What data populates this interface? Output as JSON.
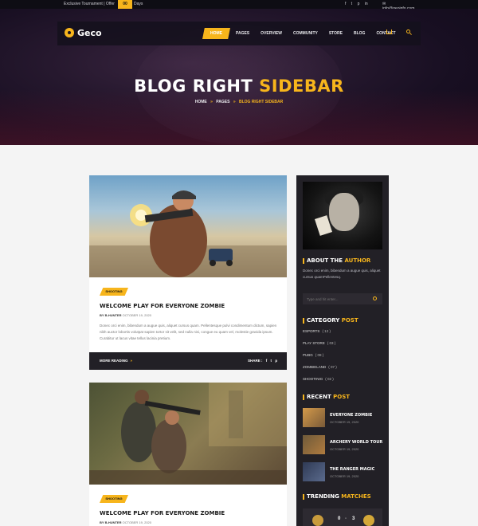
{
  "topbar": {
    "promo_text": "Exclusive Tournament | Offer",
    "promo_days_value": "00",
    "promo_days_label": "Days",
    "social_icons": [
      "facebook-icon",
      "twitter-icon",
      "pinterest-icon",
      "linkedin-icon"
    ],
    "email": "info@geoinfo.com"
  },
  "nav": {
    "logo": "Geco",
    "items": [
      "HOME",
      "PAGES",
      "OVERVIEW",
      "COMMUNITY",
      "STORE",
      "BLOG",
      "CONTACT"
    ],
    "active_index": 0
  },
  "hero": {
    "title_main": "BLOG RIGHT ",
    "title_accent": "SIDEBAR",
    "breadcrumb": [
      "HOME",
      "PAGES",
      "BLOG RIGHT SIDEBAR"
    ]
  },
  "posts": [
    {
      "tag": "SHOOTING",
      "title": "WELCOME PLAY FOR EVERYONE ZOMBIE",
      "author": "BY B-HUNTER",
      "date": "OCTOBER 19, 2020",
      "excerpt": "Donec orci enim, bibendum a augue quis, aliquet cursus quam. Pellentesque pulvi condimentum dictum, sapien nibh auctor lobortis volutpat sapien tortor sit velit, sed nulla nisi, congue eu quam vel, molestie gravida ipsum. Curabitur ut lacus vitae tellus lacinia pretium.",
      "more": "MORE READING",
      "share": "SHARE :"
    },
    {
      "tag": "SHOOTING",
      "title": "WELCOME PLAY FOR EVERYONE ZOMBIE",
      "author": "BY B-HUNTER",
      "date": "OCTOBER 19, 2020"
    }
  ],
  "sidebar": {
    "about_heading": "ABOUT THE ",
    "about_accent": "AUTHOR",
    "about_text": "Donec orci enim, bibendum a augue quis, aliquet cursus quamPellentesq.",
    "search_placeholder": "Type and hit enter...",
    "category_heading": "CATEGORY ",
    "category_accent": "POST",
    "categories": [
      {
        "name": "ESPORTS",
        "count": "( 12 )"
      },
      {
        "name": "PLAY STORE",
        "count": "( 03 )"
      },
      {
        "name": "PUBG",
        "count": "( 08 )"
      },
      {
        "name": "ZOMBIELAND",
        "count": "( 07 )"
      },
      {
        "name": "SHOOTINIG",
        "count": "( 02 )"
      }
    ],
    "recent_heading": "RECENT ",
    "recent_accent": "POST",
    "recent_posts": [
      {
        "title": "EVERYONE ZOMBIE",
        "date": "OCTOBER 19, 2020"
      },
      {
        "title": "ARCHERY WORLD TOUR",
        "date": "OCTOBER 19, 2020"
      },
      {
        "title": "THE RANGER MAGIC",
        "date": "OCTOBER 19, 2020"
      }
    ],
    "trending_heading": "TRENDING ",
    "trending_accent": "MATCHES",
    "match": {
      "home_score": "0",
      "separator": "-",
      "away_score": "3"
    }
  },
  "colors": {
    "accent": "#f7b51c",
    "dark": "#222026",
    "hero": "#1c1224"
  }
}
